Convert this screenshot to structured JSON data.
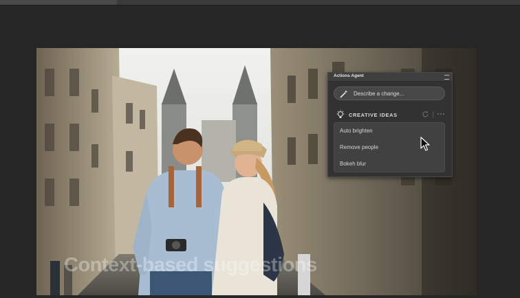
{
  "panel": {
    "title": "Actions Agent",
    "describe_placeholder": "Describe a change...",
    "ideas_header": "CREATIVE IDEAS",
    "ideas": [
      "Auto brighten",
      "Remove people",
      "Bokeh blur"
    ]
  },
  "caption": "Context-based suggestions",
  "icons": [
    "magic-wand-icon",
    "lightbulb-icon",
    "refresh-icon",
    "more-options-icon",
    "panel-menu-icon",
    "mouse-cursor-icon"
  ],
  "colors": {
    "app_background": "#262626",
    "panel_background": "#323232",
    "panel_text": "#d6d6d6"
  }
}
